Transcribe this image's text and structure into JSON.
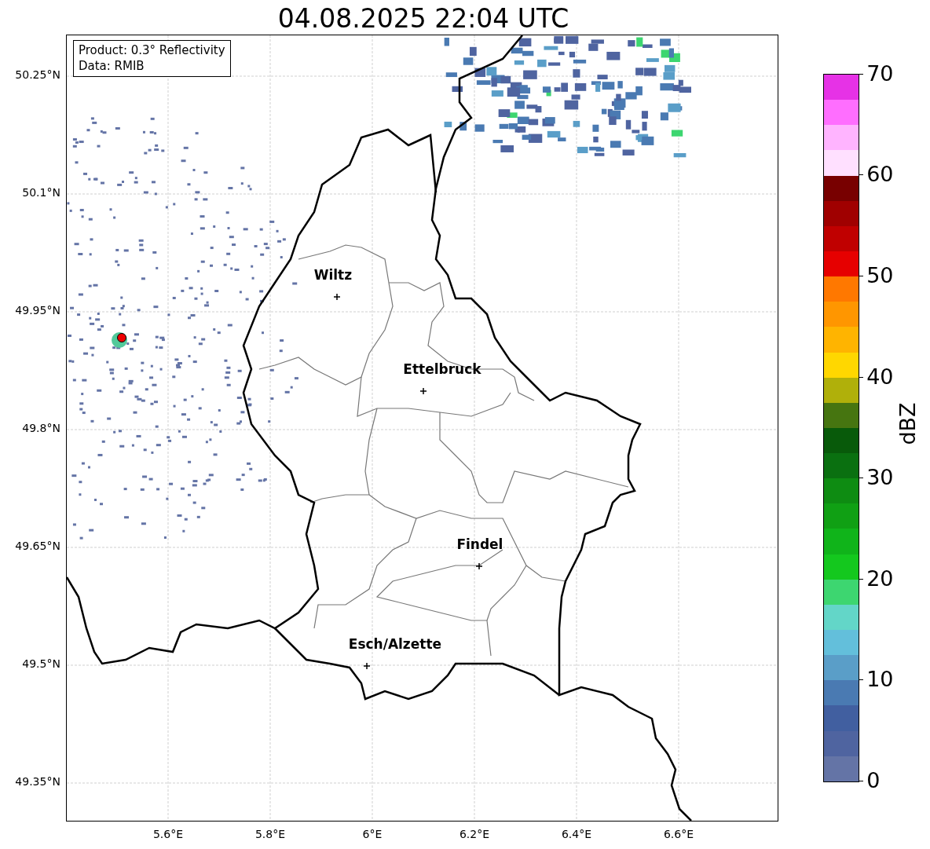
{
  "title": "04.08.2025 22:04 UTC",
  "info_box": {
    "lines": [
      "Product: 0.3° Reflectivity",
      "Data: RMIB"
    ]
  },
  "map": {
    "x_ticks": [
      "5.6°E",
      "5.8°E",
      "6°E",
      "6.2°E",
      "6.4°E",
      "6.6°E"
    ],
    "y_ticks": [
      "50.25°N",
      "50.1°N",
      "49.95°N",
      "49.8°N",
      "49.65°N",
      "49.5°N",
      "49.35°N"
    ],
    "cities": [
      {
        "name": "Wiltz"
      },
      {
        "name": "Ettelbruck"
      },
      {
        "name": "Findel"
      },
      {
        "name": "Esch/Alzette"
      }
    ]
  },
  "colorbar": {
    "label": "dBZ",
    "ticks": [
      "70",
      "60",
      "50",
      "40",
      "30",
      "20",
      "10",
      "0"
    ],
    "bins": [
      {
        "color": "#6474a6"
      },
      {
        "color": "#4f64a0"
      },
      {
        "color": "#415fa0"
      },
      {
        "color": "#4a7ab2"
      },
      {
        "color": "#5a9ec8"
      },
      {
        "color": "#63bfdb"
      },
      {
        "color": "#63d6c8"
      },
      {
        "color": "#3dd670"
      },
      {
        "color": "#14c81e"
      },
      {
        "color": "#10b41a"
      },
      {
        "color": "#10a014"
      },
      {
        "color": "#0e8c12"
      },
      {
        "color": "#0a7010"
      },
      {
        "color": "#085a0a"
      },
      {
        "color": "#467510"
      },
      {
        "color": "#b0b00a"
      },
      {
        "color": "#ffd700"
      },
      {
        "color": "#ffb400"
      },
      {
        "color": "#ff9600"
      },
      {
        "color": "#ff7800"
      },
      {
        "color": "#e60000"
      },
      {
        "color": "#c00000"
      },
      {
        "color": "#a00000"
      },
      {
        "color": "#780000"
      },
      {
        "color": "#ffe0ff"
      },
      {
        "color": "#ffb4ff"
      },
      {
        "color": "#ff6eff"
      },
      {
        "color": "#e632e6"
      }
    ]
  }
}
